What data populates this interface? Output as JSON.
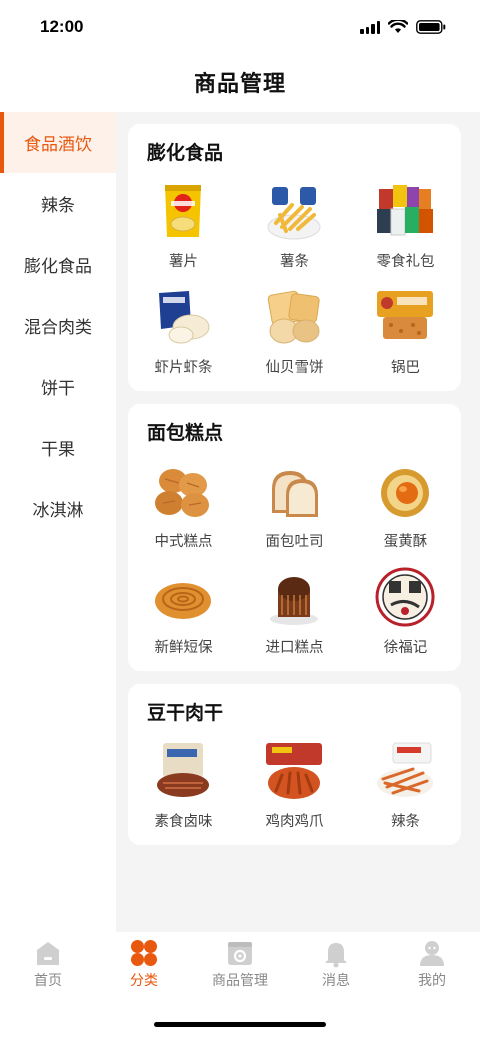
{
  "status": {
    "time": "12:00"
  },
  "nav": {
    "title": "商品管理"
  },
  "sidebar": {
    "items": [
      {
        "label": "食品酒饮",
        "active": true
      },
      {
        "label": "辣条"
      },
      {
        "label": "膨化食品"
      },
      {
        "label": "混合肉类"
      },
      {
        "label": "饼干"
      },
      {
        "label": "干果"
      },
      {
        "label": "冰淇淋"
      }
    ]
  },
  "sections": [
    {
      "title": "膨化食品",
      "items": [
        {
          "label": "薯片",
          "icon": "chips-bag-icon"
        },
        {
          "label": "薯条",
          "icon": "fries-icon"
        },
        {
          "label": "零食礼包",
          "icon": "snack-pack-icon"
        },
        {
          "label": "虾片虾条",
          "icon": "shrimp-crackers-icon"
        },
        {
          "label": "仙贝雪饼",
          "icon": "rice-cracker-icon"
        },
        {
          "label": "锅巴",
          "icon": "crispy-rice-icon"
        }
      ]
    },
    {
      "title": "面包糕点",
      "items": [
        {
          "label": "中式糕点",
          "icon": "chinese-pastry-icon"
        },
        {
          "label": "面包吐司",
          "icon": "toast-icon"
        },
        {
          "label": "蛋黄酥",
          "icon": "egg-yolk-pastry-icon"
        },
        {
          "label": "新鲜短保",
          "icon": "fresh-bread-icon"
        },
        {
          "label": "进口糕点",
          "icon": "imported-cake-icon"
        },
        {
          "label": "徐福记",
          "icon": "xufuji-logo-icon"
        }
      ]
    },
    {
      "title": "豆干肉干",
      "items": [
        {
          "label": "素食卤味",
          "icon": "vegetarian-braised-icon"
        },
        {
          "label": "鸡肉鸡爪",
          "icon": "chicken-feet-icon"
        },
        {
          "label": "辣条",
          "icon": "spicy-strips-icon"
        }
      ]
    }
  ],
  "tabbar": {
    "tabs": [
      {
        "label": "首页",
        "icon": "home-icon"
      },
      {
        "label": "分类",
        "icon": "category-icon",
        "active": true
      },
      {
        "label": "商品管理",
        "icon": "product-manage-icon"
      },
      {
        "label": "消息",
        "icon": "bell-icon"
      },
      {
        "label": "我的",
        "icon": "user-icon"
      }
    ]
  },
  "colors": {
    "accent": "#e8580f",
    "background": "#f4f4f4",
    "inactive": "#888888"
  }
}
